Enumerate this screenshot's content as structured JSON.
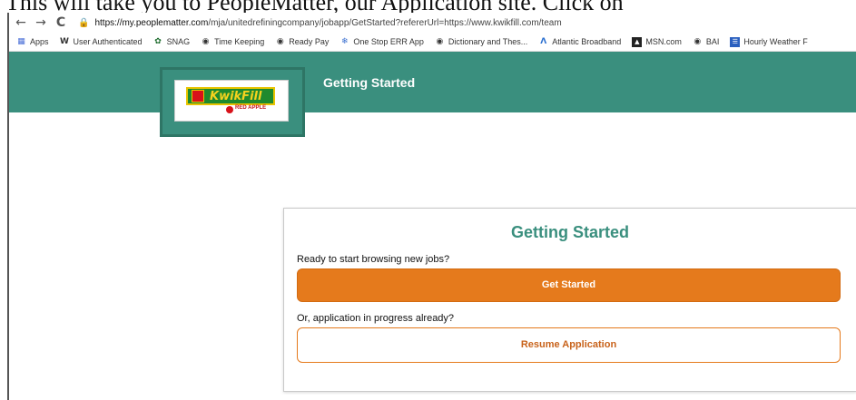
{
  "caption": "This will take you to PeopleMatter, our Application site.  Click on",
  "browser": {
    "nav": {
      "back": "←",
      "forward": "→",
      "reload": "C"
    },
    "url_host": "https://my.peoplematter.com",
    "url_path": "/mja/unitedrefiningcompany/jobapp/GetStarted?refererUrl=https://www.kwikfill.com/team",
    "bookmarks": [
      {
        "label": "Apps",
        "icon": "apps-grid-icon"
      },
      {
        "label": "User Authenticated",
        "icon": "w-icon"
      },
      {
        "label": "SNAG",
        "icon": "snag-icon"
      },
      {
        "label": "Time Keeping",
        "icon": "globe-icon"
      },
      {
        "label": "Ready Pay",
        "icon": "globe-icon"
      },
      {
        "label": "One Stop ERR App",
        "icon": "snowflake-icon"
      },
      {
        "label": "Dictionary and Thes...",
        "icon": "dictionary-icon"
      },
      {
        "label": "Atlantic Broadband",
        "icon": "atlantic-icon"
      },
      {
        "label": "MSN.com",
        "icon": "msn-icon"
      },
      {
        "label": "BAI",
        "icon": "globe-icon"
      },
      {
        "label": "Hourly Weather F",
        "icon": "weather-icon"
      }
    ]
  },
  "header": {
    "title": "Getting Started",
    "logo": {
      "brand": "KwikFill",
      "sub": "RED APPLE"
    }
  },
  "card": {
    "title": "Getting Started",
    "prompt_new": "Ready to start browsing new jobs?",
    "get_started_label": "Get Started",
    "prompt_resume": "Or, application in progress already?",
    "resume_label": "Resume Application"
  },
  "colors": {
    "header": "#3a8f7e",
    "primary_button": "#e57a1c",
    "title_text": "#3a8f7e"
  }
}
